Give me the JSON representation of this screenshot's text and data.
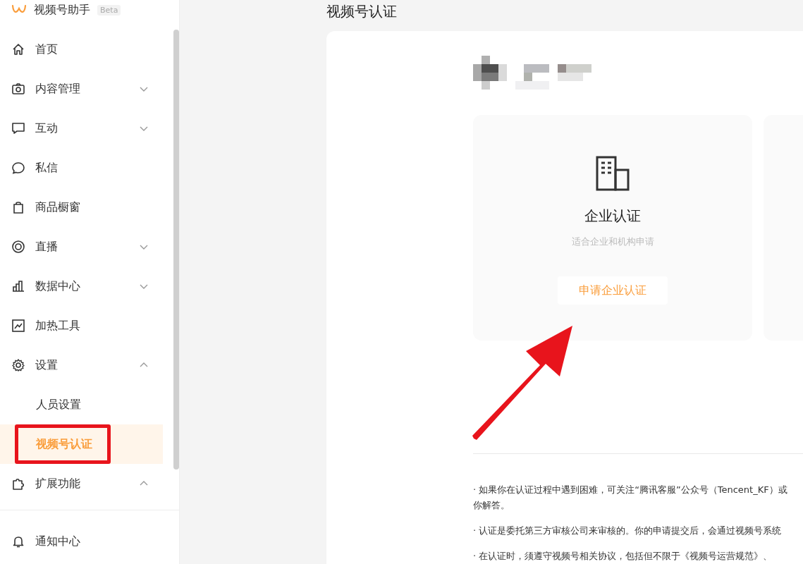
{
  "sidebar": {
    "logo": {
      "title": "视频号助手",
      "badge": "Beta"
    },
    "items": [
      {
        "label": "首页",
        "selected": false
      },
      {
        "label": "内容管理",
        "expanded": false,
        "selected": false
      },
      {
        "label": "互动",
        "expanded": false,
        "selected": false
      },
      {
        "label": "私信",
        "selected": false
      },
      {
        "label": "商品橱窗",
        "selected": false
      },
      {
        "label": "直播",
        "expanded": false,
        "selected": false
      },
      {
        "label": "数据中心",
        "expanded": false,
        "selected": false
      },
      {
        "label": "加热工具",
        "selected": false
      },
      {
        "label": "设置",
        "expanded": true,
        "selected": false,
        "children": [
          {
            "label": "人员设置",
            "selected": false
          },
          {
            "label": "视频号认证",
            "selected": true
          }
        ]
      },
      {
        "label": "扩展功能",
        "expanded": true,
        "selected": false
      }
    ],
    "footer_items": [
      {
        "label": "通知中心",
        "selected": false
      }
    ]
  },
  "page_title": "视频号认证",
  "cert_cards": [
    {
      "title": "企业认证",
      "description": "适合企业和机构申请",
      "button": "申请企业认证"
    }
  ],
  "notes": [
    {
      "lines": [
        "· 如果你在认证过程中遇到困难，可关注“腾讯客服”公众号（Tencent_KF）或",
        "你解答。"
      ]
    },
    {
      "lines": [
        "· 认证是委托第三方审核公司来审核的。你的申请提交后，会通过视频号系统"
      ]
    },
    {
      "lines": [
        "· 在认证时，须遵守视频号相关协议，包括但不限于《视频号运营规范》、"
      ]
    }
  ]
}
